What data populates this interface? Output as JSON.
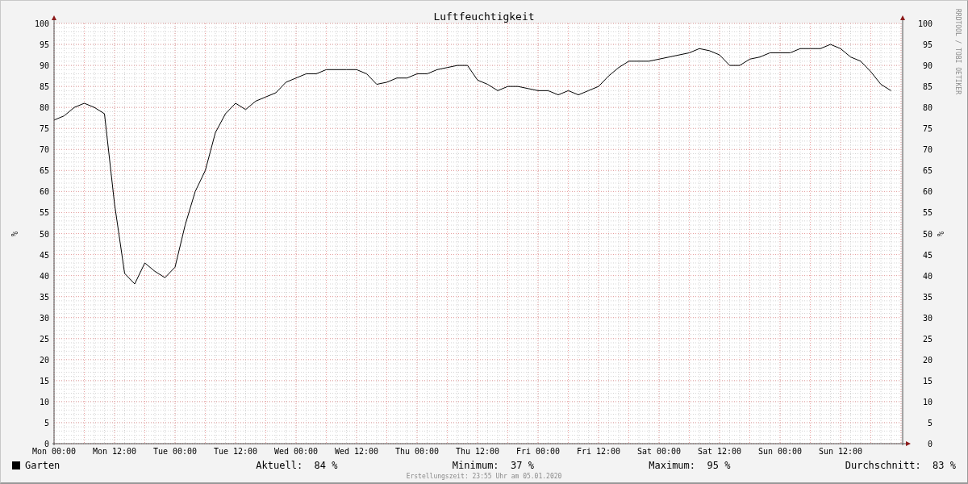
{
  "chart_data": {
    "type": "line",
    "title": "Luftfeuchtigkeit",
    "ylabel": "%",
    "ylim": [
      0,
      100
    ],
    "grid": true,
    "yticks": [
      0,
      5,
      10,
      15,
      20,
      25,
      30,
      35,
      40,
      45,
      50,
      55,
      60,
      65,
      70,
      75,
      80,
      85,
      90,
      95,
      100
    ],
    "categories": [
      "Mon 00:00",
      null,
      null,
      null,
      null,
      null,
      "Mon 12:00",
      null,
      null,
      null,
      null,
      null,
      "Tue 00:00",
      null,
      null,
      null,
      null,
      null,
      "Tue 12:00",
      null,
      null,
      null,
      null,
      null,
      "Wed 00:00",
      null,
      null,
      null,
      null,
      null,
      "Wed 12:00",
      null,
      null,
      null,
      null,
      null,
      "Thu 00:00",
      null,
      null,
      null,
      null,
      null,
      "Thu 12:00",
      null,
      null,
      null,
      null,
      null,
      "Fri 00:00",
      null,
      null,
      null,
      null,
      null,
      "Fri 12:00",
      null,
      null,
      null,
      null,
      null,
      "Sat 00:00",
      null,
      null,
      null,
      null,
      null,
      "Sat 12:00",
      null,
      null,
      null,
      null,
      null,
      "Sun 00:00",
      null,
      null,
      null,
      null,
      null,
      "Sun 12:00",
      null,
      null,
      null,
      null,
      null
    ],
    "series": [
      {
        "name": "Garten",
        "color": "#000000",
        "values": [
          77,
          78,
          80,
          81,
          80,
          78.5,
          57,
          40.5,
          38,
          43,
          41,
          39.5,
          42,
          52,
          60,
          65,
          74,
          78.5,
          81,
          79.5,
          81.5,
          82.5,
          83.5,
          86,
          87,
          88,
          88,
          89,
          89,
          89,
          89,
          88,
          85.5,
          86,
          87,
          87,
          88,
          88,
          89,
          89.5,
          90,
          90,
          86.5,
          85.5,
          84,
          85,
          85,
          84.5,
          84,
          84,
          83,
          84,
          83,
          84,
          85,
          87.5,
          89.5,
          91,
          91,
          91,
          91.5,
          92,
          92.5,
          93,
          94,
          93.5,
          92.5,
          90,
          90,
          91.5,
          92,
          93,
          93,
          93,
          94,
          94,
          94,
          95,
          94,
          92,
          91,
          88.5,
          85.5,
          84
        ]
      }
    ]
  },
  "stats": [
    {
      "label": "Aktuell:",
      "value": "84 %"
    },
    {
      "label": "Minimum:",
      "value": "37 %"
    },
    {
      "label": "Maximum:",
      "value": "95 %"
    },
    {
      "label": "Durchschnitt:",
      "value": "83 %"
    }
  ],
  "right_axis": {
    "title": "%",
    "labels": [
      "100",
      "95",
      "90",
      "85",
      "80",
      "75",
      "70",
      "65",
      "60",
      "55",
      "50",
      "45",
      "40",
      "35",
      "30",
      "25",
      "20",
      "15",
      "10",
      "5",
      "0"
    ]
  },
  "credit": "RRDTOOL / TOBI OETIKER",
  "footer": "Erstellungszeit: 23:55 Uhr am 05.01.2020"
}
